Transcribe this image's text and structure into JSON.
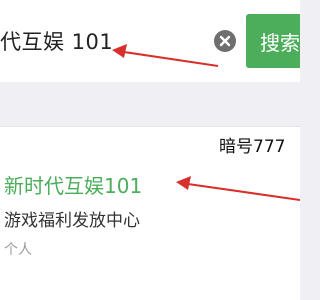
{
  "search": {
    "query": "代互娱 101",
    "button_label": "搜索"
  },
  "annotation": {
    "code_label": "暗号777"
  },
  "result": {
    "name": "新时代互娱101",
    "description": "游戏福利发放中心",
    "type": "个人"
  },
  "colors": {
    "accent": "#4cae5b",
    "arrow": "#d8302c"
  },
  "icons": {
    "clear": "clear-icon",
    "arrow": "arrow-icon"
  }
}
